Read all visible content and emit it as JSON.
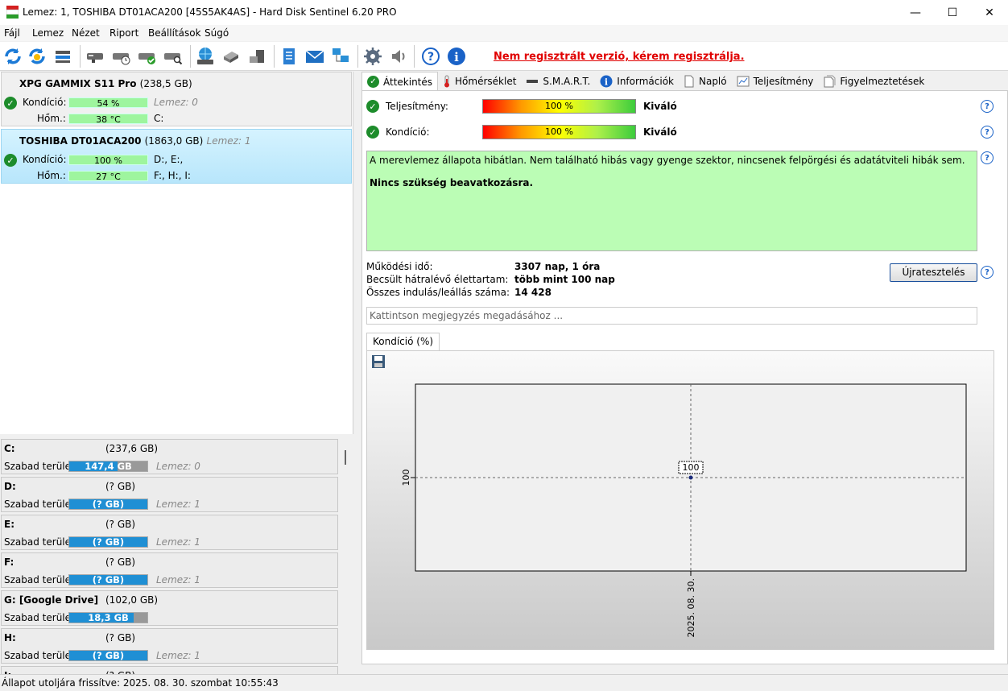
{
  "window": {
    "title": "Lemez: 1, TOSHIBA DT01ACA200 [45S5AK4AS]  -  Hard Disk Sentinel 6.20 PRO",
    "minimize": "—",
    "maximize": "☐",
    "close": "✕"
  },
  "menu": {
    "file": "Fájl",
    "disk": "Lemez",
    "view": "Nézet",
    "report": "Riport",
    "settings": "Beállítások",
    "help": "Súgó"
  },
  "toolbar": {
    "registration_warning": "Nem regisztrált verzió, kérem regisztrálja.",
    "icons": [
      "refresh-icon",
      "refresh-all-icon",
      "disk-stack-icon",
      "disk-info-icon",
      "disk-schedule-icon",
      "disk-ok-icon",
      "disk-search-icon",
      "network-disk-icon",
      "usb-disk-icon",
      "external-disk-icon",
      "report-icon",
      "email-icon",
      "network-icon",
      "settings-icon",
      "sound-icon",
      "help-icon",
      "info-icon"
    ]
  },
  "disks": [
    {
      "name": "XPG GAMMIX S11 Pro",
      "capacity": "(238,5 GB)",
      "disk_label": "",
      "condition_label": "Kondíció:",
      "condition_value": "54 %",
      "condition_disk": "Lemez: 0",
      "temp_label": "Hőm.:",
      "temp_value": "38 °C",
      "drives": "C:"
    },
    {
      "name": "TOSHIBA DT01ACA200",
      "capacity": "(1863,0 GB)",
      "disk_label": "Lemez: 1",
      "condition_label": "Kondíció:",
      "condition_value": "100 %",
      "drives_line1": "D:, E:,",
      "temp_label": "Hőm.:",
      "temp_value": "27 °C",
      "drives": "F:, H:, I:"
    }
  ],
  "volumes": [
    {
      "letter": "C:",
      "size": "(237,6 GB)",
      "free_label": "Szabad terület",
      "free": "147,4 GB",
      "free_fraction": 0.62,
      "disk": "Lemez: 0"
    },
    {
      "letter": "D:",
      "size": "(? GB)",
      "free_label": "Szabad terület",
      "free": "(? GB)",
      "free_fraction": 1.0,
      "disk": "Lemez: 1"
    },
    {
      "letter": "E:",
      "size": "(? GB)",
      "free_label": "Szabad terület",
      "free": "(? GB)",
      "free_fraction": 1.0,
      "disk": "Lemez: 1"
    },
    {
      "letter": "F:",
      "size": "(? GB)",
      "free_label": "Szabad terület",
      "free": "(? GB)",
      "free_fraction": 1.0,
      "disk": "Lemez: 1"
    },
    {
      "letter": "G: [Google Drive]",
      "size": "(102,0 GB)",
      "free_label": "Szabad terület",
      "free": "18,3 GB",
      "free_fraction": 0.82,
      "disk": ""
    },
    {
      "letter": "H:",
      "size": "(? GB)",
      "free_label": "Szabad terület",
      "free": "(? GB)",
      "free_fraction": 1.0,
      "disk": "Lemez: 1"
    },
    {
      "letter": "I:",
      "size": "(? GB)",
      "free_label": "",
      "free": "",
      "free_fraction": 0,
      "disk": ""
    }
  ],
  "tabs": [
    {
      "label": "Áttekintés",
      "icon": "check-icon"
    },
    {
      "label": "Hőmérséklet",
      "icon": "thermometer-icon"
    },
    {
      "label": "S.M.A.R.T.",
      "icon": "smart-icon"
    },
    {
      "label": "Információk",
      "icon": "info-icon"
    },
    {
      "label": "Napló",
      "icon": "log-icon"
    },
    {
      "label": "Teljesítmény",
      "icon": "performance-icon"
    },
    {
      "label": "Figyelmeztetések",
      "icon": "alerts-icon"
    }
  ],
  "overview": {
    "performance_label": "Teljesítmény:",
    "performance_value": "100 %",
    "performance_rating": "Kiváló",
    "condition_label": "Kondíció:",
    "condition_value": "100 %",
    "condition_rating": "Kiváló",
    "message": "A merevlemez állapota hibátlan. Nem található hibás vagy gyenge szektor, nincsenek felpörgési és adatátviteli hibák sem.",
    "message_action": "Nincs szükség beavatkozásra.",
    "uptime_label": "Működési idő:",
    "uptime_value": "3307 nap, 1 óra",
    "lifetime_label": "Becsült hátralévő élettartam:",
    "lifetime_value": "több mint 100 nap",
    "starts_label": "Összes indulás/leállás száma:",
    "starts_value": "14 428",
    "retest_button": "Újratesztelés",
    "note_placeholder": "Kattintson megjegyzés megadásához ...",
    "chart_tab": "Kondíció  (%)"
  },
  "chart_data": {
    "type": "line",
    "x": [
      "2025. 08. 30."
    ],
    "series": [
      {
        "values": [
          100
        ]
      }
    ],
    "ylabel_tick": "100",
    "point_label": "100",
    "xlabel_tick": "2025. 08. 30."
  },
  "status": {
    "text": "Állapot utoljára frissítve: 2025. 08. 30. szombat 10:55:43"
  }
}
